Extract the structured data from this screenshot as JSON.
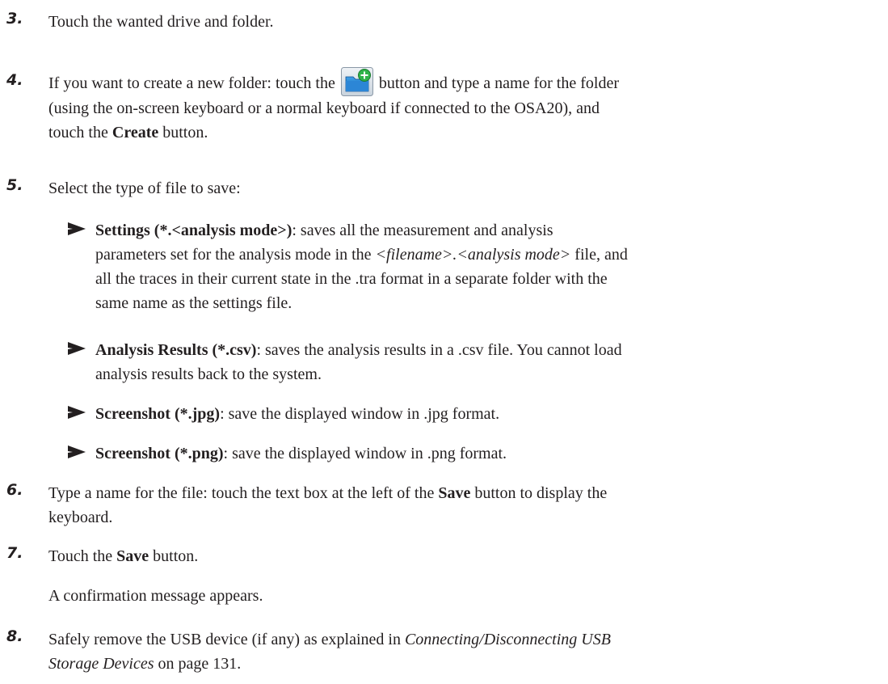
{
  "steps": [
    {
      "num": "3.",
      "text": "Touch the wanted drive and folder."
    },
    {
      "num": "4.",
      "pre": "If you want to create a new folder: touch the",
      "post": "button and type a name for the folder",
      "line2": "(using the on-screen keyboard or a normal keyboard if connected to the OSA20), and",
      "line3_pre": "touch the",
      "line3_bold": "Create",
      "line3_post": "button."
    },
    {
      "num": "5.",
      "text": "Select the type of file to save:"
    },
    {
      "num": "6.",
      "pre": "Type a name for the file: touch the text box at the left of the",
      "bold": "Save",
      "post": "button to display the",
      "line2": "keyboard."
    },
    {
      "num": "7.",
      "pre": "Touch the",
      "bold": "Save",
      "post": "button."
    },
    {
      "num": "8.",
      "line1": "Safely remove the USB device (if any) as explained in",
      "link1": "Connecting/Disconnecting USB",
      "link2": "Storage Devices",
      "post": "on page 131."
    }
  ],
  "bullets": [
    {
      "label": "Settings (*.<analysis mode>)",
      "line1": ": saves all the measurement and analysis",
      "line2_pre": "parameters set for the analysis mode in the",
      "line2_i": "<filename>.<analysis mode>",
      "line2_post": "file, and",
      "line3": "all the traces in their current state in the .tra format in a separate folder with the",
      "line4": "same name as the settings file."
    },
    {
      "label": "Analysis Results (*.csv)",
      "line1": ": saves the analysis results in a .csv file. You cannot load",
      "line2": "analysis results back to the system."
    },
    {
      "label": "Screenshot (*.jpg)",
      "line1": ": save the displayed window in .jpg format."
    },
    {
      "label": "Screenshot (*.png)",
      "line1": ": save the displayed window in .png format."
    }
  ],
  "confirmation": "A confirmation message appears.",
  "icon": "new-folder-icon"
}
